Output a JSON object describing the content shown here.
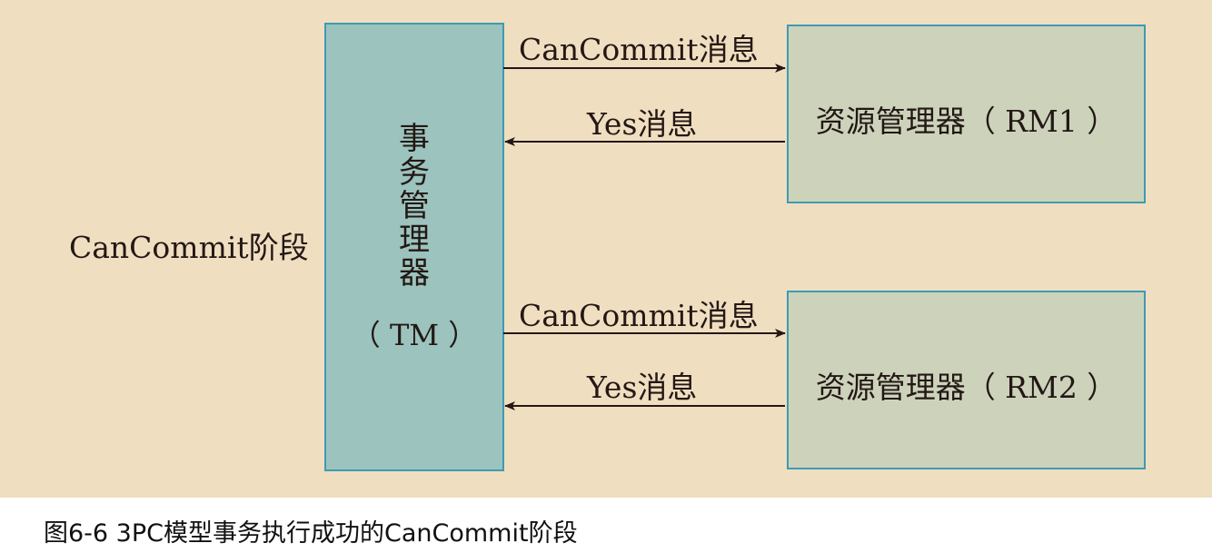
{
  "diagram": {
    "phase_label": "CanCommit阶段",
    "transaction_manager": {
      "title_chars": [
        "事",
        "务",
        "管",
        "理",
        "器"
      ],
      "abbreviation": "（ TM ）"
    },
    "resource_managers": [
      {
        "label": "资源管理器（ RM1 ）",
        "request_message": "CanCommit消息",
        "response_message": "Yes消息"
      },
      {
        "label": "资源管理器（ RM2 ）",
        "request_message": "CanCommit消息",
        "response_message": "Yes消息"
      }
    ],
    "colors": {
      "background": "#f0dec0",
      "tm_fill": "#9cc3bd",
      "rm_fill": "#cdd3bb",
      "border": "#3e9bb4",
      "arrow": "#231815"
    }
  },
  "caption": "图6-6 3PC模型事务执行成功的CanCommit阶段"
}
